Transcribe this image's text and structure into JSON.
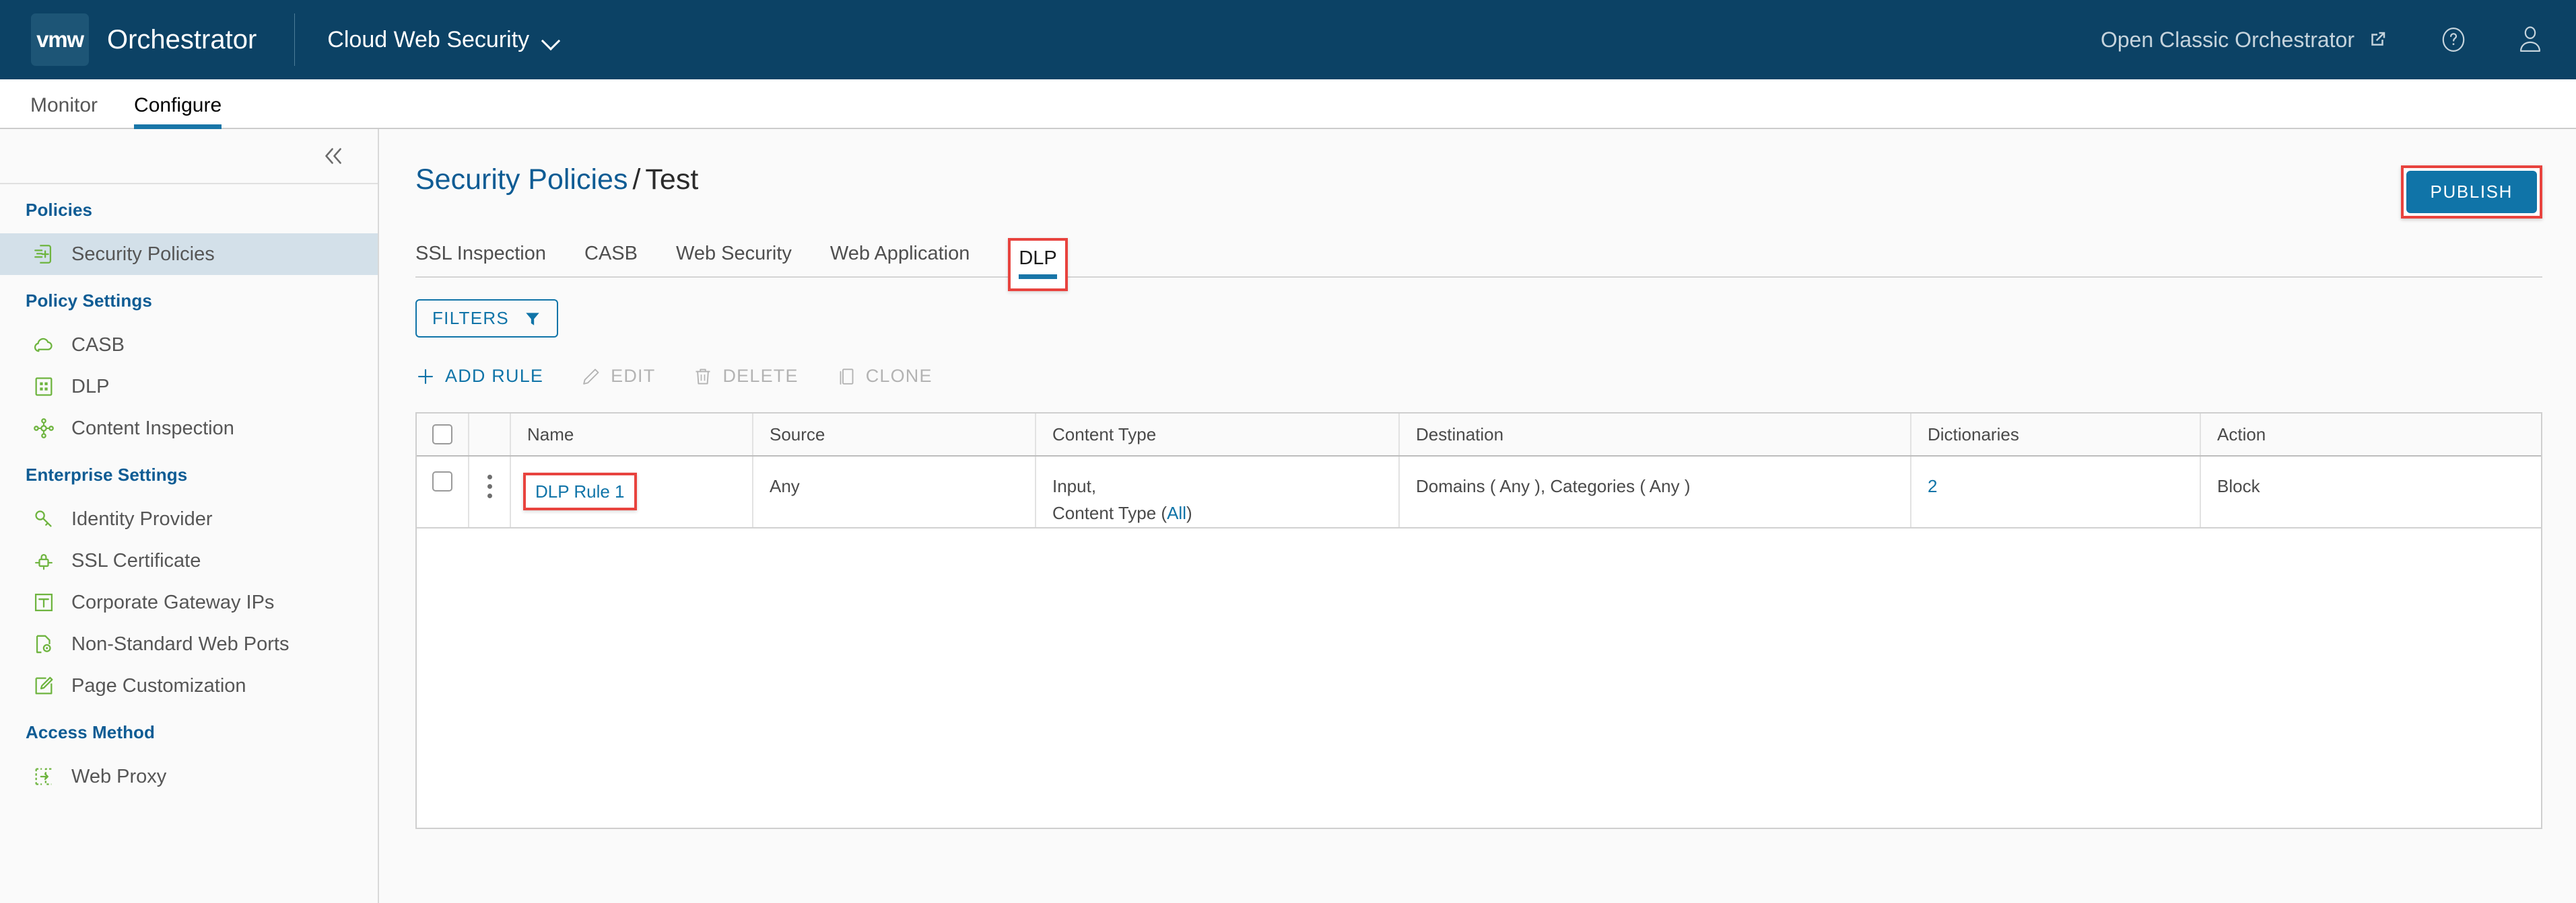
{
  "header": {
    "logo_text": "vmw",
    "logo_icon": "vmware-logo-icon",
    "product_title": "Orchestrator",
    "context": "Cloud Web Security",
    "context_chevron_icon": "chevron-down-icon",
    "open_classic": "Open Classic Orchestrator",
    "external_link_icon": "external-link-icon",
    "help_icon": "help-circle-icon",
    "user_icon": "user-avatar-icon"
  },
  "nav": {
    "tabs": [
      {
        "label": "Monitor",
        "active": false
      },
      {
        "label": "Configure",
        "active": true
      }
    ]
  },
  "sidebar": {
    "collapse_icon": "double-chevron-left-icon",
    "groups": [
      {
        "title": "Policies",
        "items": [
          {
            "label": "Security Policies",
            "icon": "policy-add-icon",
            "selected": true
          }
        ]
      },
      {
        "title": "Policy Settings",
        "items": [
          {
            "label": "CASB",
            "icon": "cloud-icon",
            "selected": false
          },
          {
            "label": "DLP",
            "icon": "grid-card-icon",
            "selected": false
          },
          {
            "label": "Content Inspection",
            "icon": "network-nodes-icon",
            "selected": false
          }
        ]
      },
      {
        "title": "Enterprise Settings",
        "items": [
          {
            "label": "Identity Provider",
            "icon": "key-icon",
            "selected": false
          },
          {
            "label": "SSL Certificate",
            "icon": "certificate-lock-icon",
            "selected": false
          },
          {
            "label": "Corporate Gateway IPs",
            "icon": "gateway-icon",
            "selected": false
          },
          {
            "label": "Non-Standard Web Ports",
            "icon": "port-settings-icon",
            "selected": false
          },
          {
            "label": "Page Customization",
            "icon": "pencil-square-icon",
            "selected": false
          }
        ]
      },
      {
        "title": "Access Method",
        "items": [
          {
            "label": "Web Proxy",
            "icon": "proxy-arrow-icon",
            "selected": false
          }
        ]
      }
    ]
  },
  "page": {
    "breadcrumb_link": "Security Policies",
    "breadcrumb_separator": "/",
    "breadcrumb_current": "Test",
    "publish_label": "PUBLISH"
  },
  "subtabs": [
    {
      "label": "SSL Inspection",
      "active": false,
      "highlighted": false
    },
    {
      "label": "CASB",
      "active": false,
      "highlighted": false
    },
    {
      "label": "Web Security",
      "active": false,
      "highlighted": false
    },
    {
      "label": "Web Application",
      "active": false,
      "highlighted": false
    },
    {
      "label": "DLP",
      "active": true,
      "highlighted": true
    }
  ],
  "filters": {
    "label": "FILTERS",
    "icon": "funnel-icon"
  },
  "actions": [
    {
      "label": "ADD RULE",
      "icon": "plus-icon",
      "enabled": true
    },
    {
      "label": "EDIT",
      "icon": "pencil-icon",
      "enabled": false
    },
    {
      "label": "DELETE",
      "icon": "trash-icon",
      "enabled": false
    },
    {
      "label": "CLONE",
      "icon": "copy-icon",
      "enabled": false
    }
  ],
  "table": {
    "columns": [
      "Name",
      "Source",
      "Content Type",
      "Destination",
      "Dictionaries",
      "Action"
    ],
    "select_all_icon": "checkbox-icon",
    "rows": [
      {
        "row_checkbox_icon": "checkbox-icon",
        "row_menu_icon": "kebab-menu-icon",
        "name": "DLP Rule 1",
        "source": "Any",
        "content_type_line1": "Input,",
        "content_type_line2_prefix": "Content Type (",
        "content_type_link": "All",
        "content_type_line2_suffix": ")",
        "destination": "Domains ( Any ), Categories ( Any )",
        "dictionaries": "2",
        "action": "Block"
      }
    ]
  },
  "colors": {
    "header_bg": "#0c4265",
    "accent_blue": "#1074a8",
    "link_blue": "#0f5c94",
    "highlight_red": "#e8433e",
    "sidebar_selected": "#d3e0e9",
    "icon_green": "#6eb43f"
  }
}
